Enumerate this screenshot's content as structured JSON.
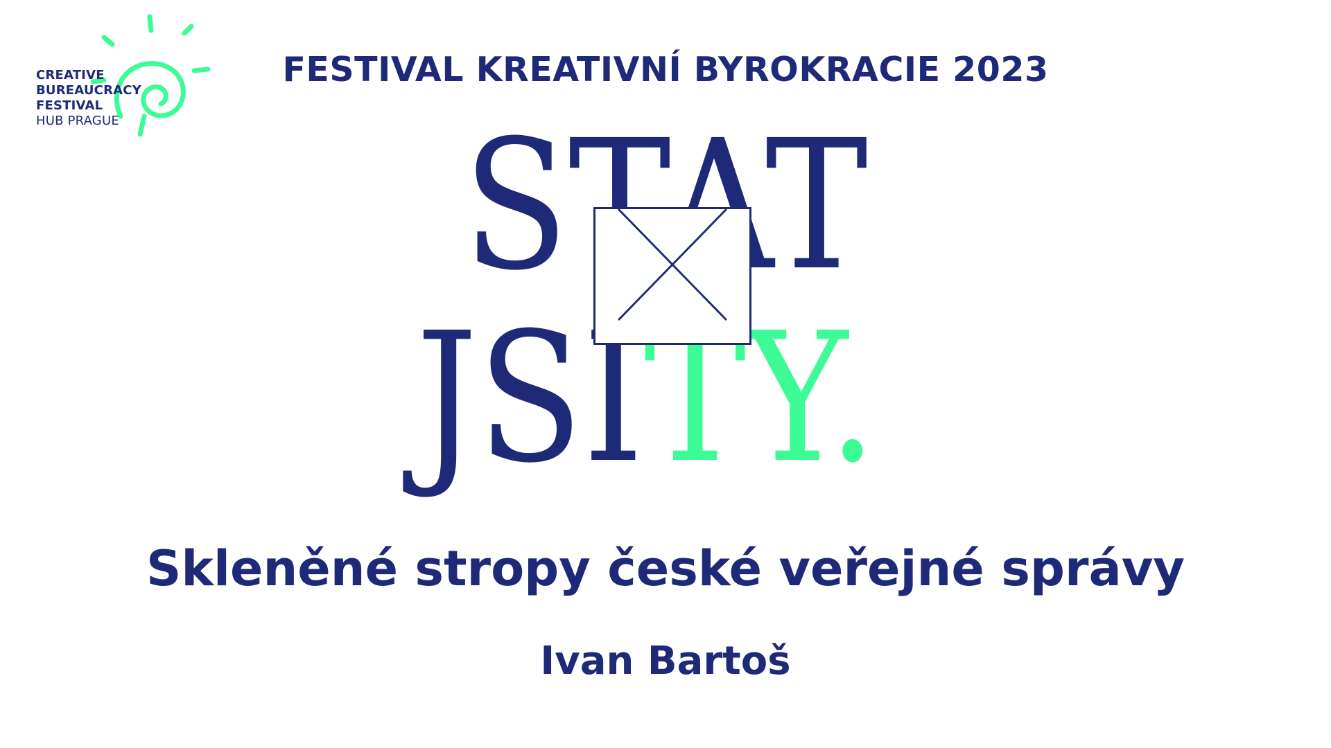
{
  "colors": {
    "navy": "#1e2a78",
    "green": "#3dfb95",
    "background": "#ffffff"
  },
  "logo": {
    "lines": [
      "CREATIVE",
      "BUREAUCRACY",
      "FESTIVAL",
      "HUB PRAGUE"
    ],
    "icon": "sun-spiral-icon"
  },
  "festival_title": "FESTIVAL KREATIVNÍ BYROKRACIE 2023",
  "wordmark": {
    "line1": "STAT",
    "line2_navy": "JSI",
    "line2_green": "TY.",
    "ballot_icon": "ballot-box-x-icon"
  },
  "talk_title": "Skleněné stropy české veřejné správy",
  "speaker": "Ivan Bartoš"
}
